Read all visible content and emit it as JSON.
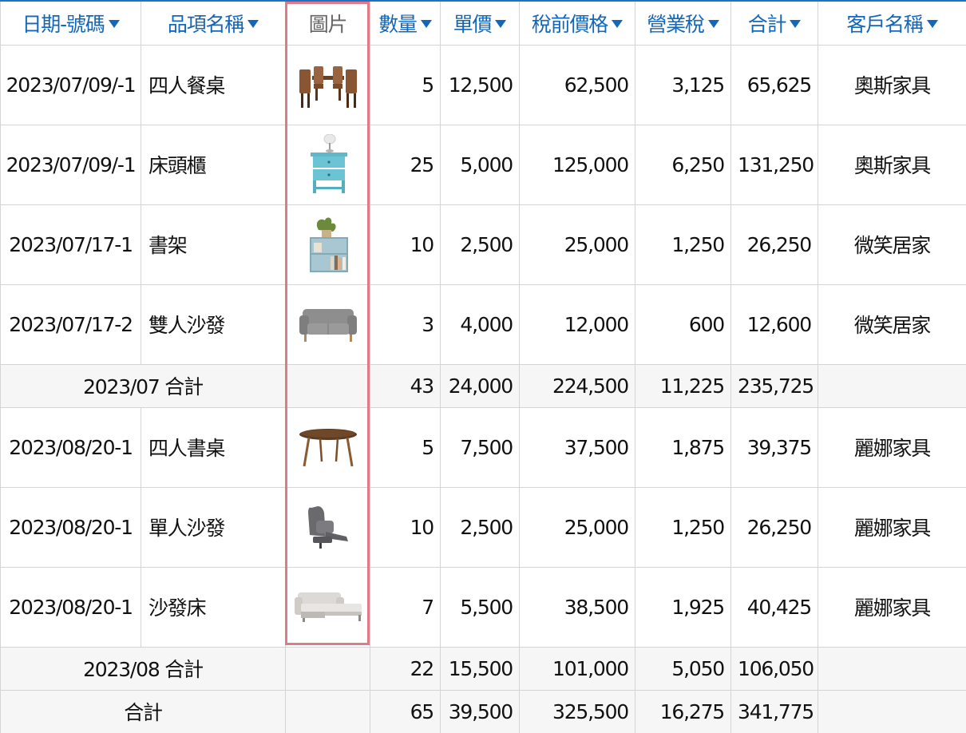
{
  "header": {
    "date": "日期-號碼",
    "item": "品項名稱",
    "image": "圖片",
    "qty": "數量",
    "price": "單價",
    "pretax": "稅前價格",
    "tax": "營業稅",
    "total": "合計",
    "customer": "客戶名稱"
  },
  "accent_color": "#1467b8",
  "highlight_color": "#e07a86",
  "rows": [
    {
      "date": "2023/07/09/-1",
      "item": "四人餐桌",
      "image": "dining-set-image",
      "qty": "5",
      "price": "12,500",
      "pretax": "62,500",
      "tax": "3,125",
      "total": "65,625",
      "customer": "奧斯家具"
    },
    {
      "date": "2023/07/09/-1",
      "item": "床頭櫃",
      "image": "nightstand-image",
      "qty": "25",
      "price": "5,000",
      "pretax": "125,000",
      "tax": "6,250",
      "total": "131,250",
      "customer": "奧斯家具"
    },
    {
      "date": "2023/07/17-1",
      "item": "書架",
      "image": "bookshelf-image",
      "qty": "10",
      "price": "2,500",
      "pretax": "25,000",
      "tax": "1,250",
      "total": "26,250",
      "customer": "微笑居家"
    },
    {
      "date": "2023/07/17-2",
      "item": "雙人沙發",
      "image": "loveseat-image",
      "qty": "3",
      "price": "4,000",
      "pretax": "12,000",
      "tax": "600",
      "total": "12,600",
      "customer": "微笑居家"
    }
  ],
  "subtotal_july": {
    "label": "2023/07 合計",
    "qty": "43",
    "price": "24,000",
    "pretax": "224,500",
    "tax": "11,225",
    "total": "235,725"
  },
  "rows_aug": [
    {
      "date": "2023/08/20-1",
      "item": "四人書桌",
      "image": "oval-desk-image",
      "qty": "5",
      "price": "7,500",
      "pretax": "37,500",
      "tax": "1,875",
      "total": "39,375",
      "customer": "麗娜家具"
    },
    {
      "date": "2023/08/20-1",
      "item": "單人沙發",
      "image": "recliner-image",
      "qty": "10",
      "price": "2,500",
      "pretax": "25,000",
      "tax": "1,250",
      "total": "26,250",
      "customer": "麗娜家具"
    },
    {
      "date": "2023/08/20-1",
      "item": "沙發床",
      "image": "sofa-bed-image",
      "qty": "7",
      "price": "5,500",
      "pretax": "38,500",
      "tax": "1,925",
      "total": "40,425",
      "customer": "麗娜家具"
    }
  ],
  "subtotal_aug": {
    "label": "2023/08 合計",
    "qty": "22",
    "price": "15,500",
    "pretax": "101,000",
    "tax": "5,050",
    "total": "106,050"
  },
  "grand_total": {
    "label": "合計",
    "qty": "65",
    "price": "39,500",
    "pretax": "325,500",
    "tax": "16,275",
    "total": "341,775"
  }
}
